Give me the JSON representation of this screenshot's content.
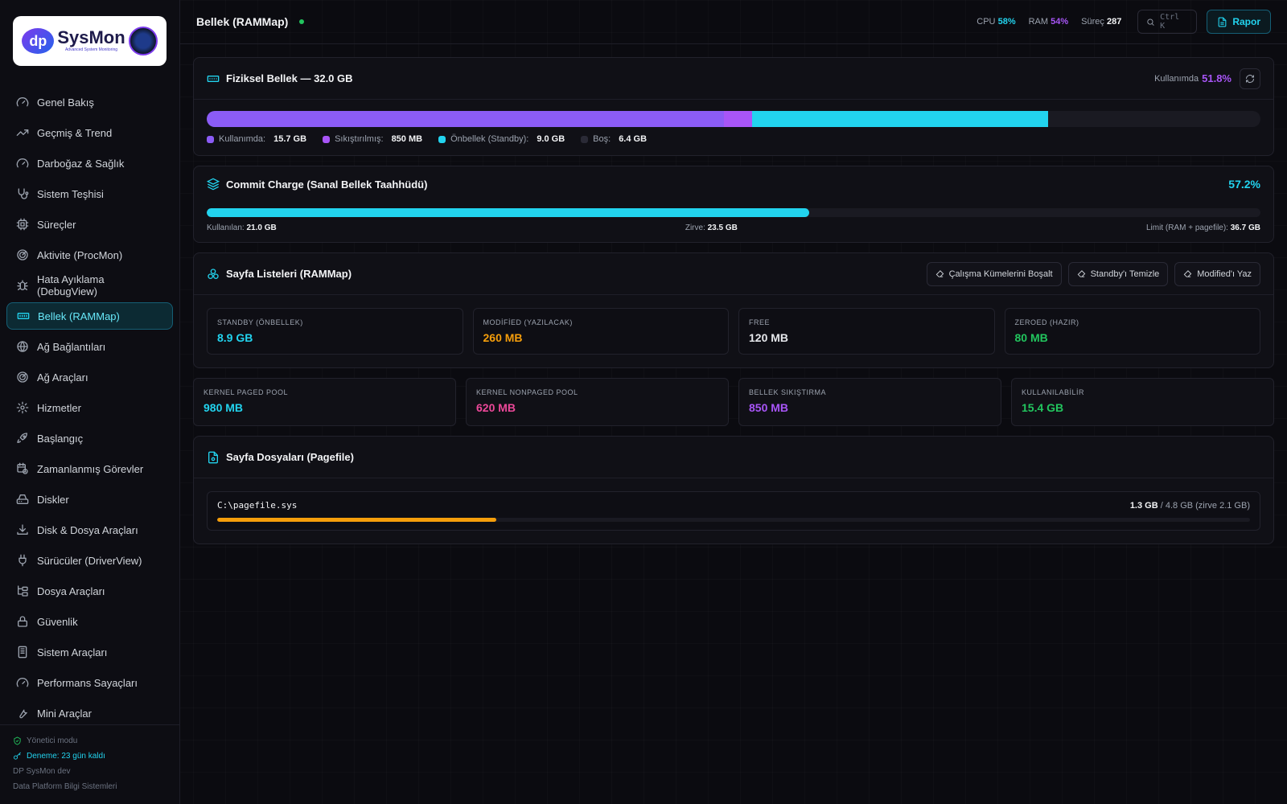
{
  "app": {
    "logo_text": "SysMon",
    "logo_mark": "dp",
    "logo_sub": "Advanced System Monitoring"
  },
  "sidebar": {
    "items": [
      {
        "label": "Genel Bakış",
        "icon": "gauge-icon"
      },
      {
        "label": "Geçmiş & Trend",
        "icon": "trend-icon"
      },
      {
        "label": "Darboğaz & Sağlık",
        "icon": "gauge-icon"
      },
      {
        "label": "Sistem Teşhisi",
        "icon": "stethoscope-icon"
      },
      {
        "label": "Süreçler",
        "icon": "cpu-icon"
      },
      {
        "label": "Aktivite (ProcMon)",
        "icon": "radar-icon"
      },
      {
        "label": "Hata Ayıklama (DebugView)",
        "icon": "bug-icon"
      },
      {
        "label": "Bellek (RAMMap)",
        "icon": "memory-icon"
      },
      {
        "label": "Ağ Bağlantıları",
        "icon": "globe-icon"
      },
      {
        "label": "Ağ Araçları",
        "icon": "radar-icon"
      },
      {
        "label": "Hizmetler",
        "icon": "cog-icon"
      },
      {
        "label": "Başlangıç",
        "icon": "rocket-icon"
      },
      {
        "label": "Zamanlanmış Görevler",
        "icon": "calendar-clock-icon"
      },
      {
        "label": "Diskler",
        "icon": "hard-drive-icon"
      },
      {
        "label": "Disk & Dosya Araçları",
        "icon": "download-icon"
      },
      {
        "label": "Sürücüler (DriverView)",
        "icon": "plug-icon"
      },
      {
        "label": "Dosya Araçları",
        "icon": "folder-tree-icon"
      },
      {
        "label": "Güvenlik",
        "icon": "lock-icon"
      },
      {
        "label": "Sistem Araçları",
        "icon": "server-icon"
      },
      {
        "label": "Performans Sayaçları",
        "icon": "gauge-icon"
      },
      {
        "label": "Mini Araçlar",
        "icon": "wrench-icon"
      }
    ],
    "active_index": 7,
    "footer": {
      "admin": "Yönetici modu",
      "trial": "Deneme: 23 gün kaldı",
      "version": "DP SysMon dev",
      "company": "Data Platform Bilgi Sistemleri"
    }
  },
  "header": {
    "title": "Bellek (RAMMap)",
    "cpu_label": "CPU",
    "cpu_value": "58%",
    "ram_label": "RAM",
    "ram_value": "54%",
    "proc_label": "Süreç",
    "proc_value": "287",
    "search_shortcut": "Ctrl K",
    "report_label": "Rapor"
  },
  "physical": {
    "title": "Fiziksel Bellek — 32.0 GB",
    "usage_label": "Kullanımda",
    "usage_value": "51.8%",
    "segments": [
      {
        "label": "Kullanımda:",
        "value": "15.7 GB",
        "gb": 15.7,
        "color": "#8b5cf6"
      },
      {
        "label": "Sıkıştırılmış:",
        "value": "850 MB",
        "gb": 0.85,
        "color": "#a855f7"
      },
      {
        "label": "Önbellek (Standby):",
        "value": "9.0 GB",
        "gb": 9.0,
        "color": "#22d3ee"
      },
      {
        "label": "Boş:",
        "value": "6.4 GB",
        "gb": 6.4,
        "color": "#1a1a22"
      }
    ],
    "total_gb": 32.0
  },
  "commit": {
    "title": "Commit Charge (Sanal Bellek Taahhüdü)",
    "percent": "57.2%",
    "fraction": 0.572,
    "used_label": "Kullanılan:",
    "used_value": "21.0 GB",
    "peak_label": "Zirve:",
    "peak_value": "23.5 GB",
    "limit_label": "Limit (RAM + pagefile):",
    "limit_value": "36.7 GB"
  },
  "page_lists": {
    "title": "Sayfa Listeleri (RAMMap)",
    "actions": [
      "Çalışma Kümelerini Boşalt",
      "Standby'ı Temizle",
      "Modified'ı Yaz"
    ],
    "tiles": [
      {
        "label": "STANDBY (ÖNBELLEK)",
        "value": "8.9 GB",
        "color": "#22d3ee"
      },
      {
        "label": "MODİFİED (YAZILACAK)",
        "value": "260 MB",
        "color": "#f59e0b"
      },
      {
        "label": "FREE",
        "value": "120 MB",
        "color": "#e5e7eb"
      },
      {
        "label": "ZEROED (HAZIR)",
        "value": "80 MB",
        "color": "#22c55e"
      }
    ]
  },
  "pools": [
    {
      "label": "KERNEL PAGED POOL",
      "value": "980 MB",
      "color": "#22d3ee"
    },
    {
      "label": "KERNEL NONPAGED POOL",
      "value": "620 MB",
      "color": "#ec4899"
    },
    {
      "label": "BELLEK SIKIŞTIRMA",
      "value": "850 MB",
      "color": "#a855f7"
    },
    {
      "label": "KULLANILABİLİR",
      "value": "15.4 GB",
      "color": "#22c55e"
    }
  ],
  "pagefile": {
    "title": "Sayfa Dosyaları (Pagefile)",
    "path": "C:\\pagefile.sys",
    "used": "1.3 GB",
    "rest": " / 4.8 GB (zirve 2.1 GB)",
    "fraction": 0.27
  },
  "colors": {
    "accent": "#22d3ee",
    "purple": "#a855f7",
    "cpu": "#22d3ee",
    "ram": "#a855f7"
  }
}
